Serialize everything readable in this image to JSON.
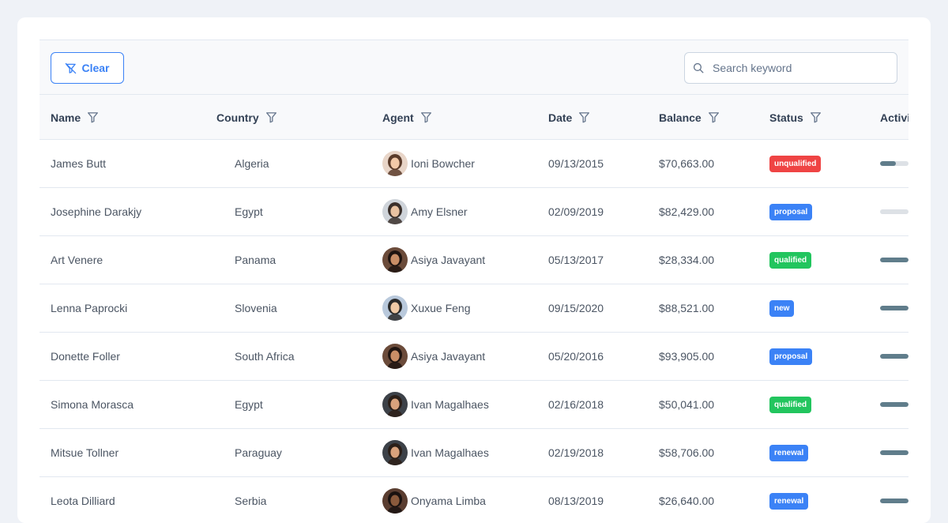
{
  "toolbar": {
    "clear_label": "Clear",
    "search_placeholder": "Search keyword",
    "search_value": ""
  },
  "columns": [
    "Name",
    "Country",
    "Agent",
    "Date",
    "Balance",
    "Status",
    "Activity"
  ],
  "status_colors": {
    "unqualified": "#ef4444",
    "proposal": "#3b82f6",
    "qualified": "#22c55e",
    "new": "#3b82f6",
    "renewal": "#3b82f6",
    "negotiation": "#3b82f6"
  },
  "rows": [
    {
      "name": "James Butt",
      "country": "Algeria",
      "agent": "Ioni Bowcher",
      "avatar_icon": "avatar-ioni-icon",
      "date": "09/13/2015",
      "balance": "$70,663.00",
      "status": "unqualified",
      "activity": 0.55
    },
    {
      "name": "Josephine Darakjy",
      "country": "Egypt",
      "agent": "Amy Elsner",
      "avatar_icon": "avatar-amy-icon",
      "date": "02/09/2019",
      "balance": "$82,429.00",
      "status": "proposal",
      "activity": 0.0
    },
    {
      "name": "Art Venere",
      "country": "Panama",
      "agent": "Asiya Javayant",
      "avatar_icon": "avatar-asiya-icon",
      "date": "05/13/2017",
      "balance": "$28,334.00",
      "status": "qualified",
      "activity": 1.0
    },
    {
      "name": "Lenna Paprocki",
      "country": "Slovenia",
      "agent": "Xuxue Feng",
      "avatar_icon": "avatar-xuxue-icon",
      "date": "09/15/2020",
      "balance": "$88,521.00",
      "status": "new",
      "activity": 1.0
    },
    {
      "name": "Donette Foller",
      "country": "South Africa",
      "agent": "Asiya Javayant",
      "avatar_icon": "avatar-asiya-icon",
      "date": "05/20/2016",
      "balance": "$93,905.00",
      "status": "proposal",
      "activity": 1.0
    },
    {
      "name": "Simona Morasca",
      "country": "Egypt",
      "agent": "Ivan Magalhaes",
      "avatar_icon": "avatar-ivan-icon",
      "date": "02/16/2018",
      "balance": "$50,041.00",
      "status": "qualified",
      "activity": 1.0
    },
    {
      "name": "Mitsue Tollner",
      "country": "Paraguay",
      "agent": "Ivan Magalhaes",
      "avatar_icon": "avatar-ivan-icon",
      "date": "02/19/2018",
      "balance": "$58,706.00",
      "status": "renewal",
      "activity": 1.0
    },
    {
      "name": "Leota Dilliard",
      "country": "Serbia",
      "agent": "Onyama Limba",
      "avatar_icon": "avatar-onyama-icon",
      "date": "08/13/2019",
      "balance": "$26,640.00",
      "status": "renewal",
      "activity": 1.0
    }
  ]
}
